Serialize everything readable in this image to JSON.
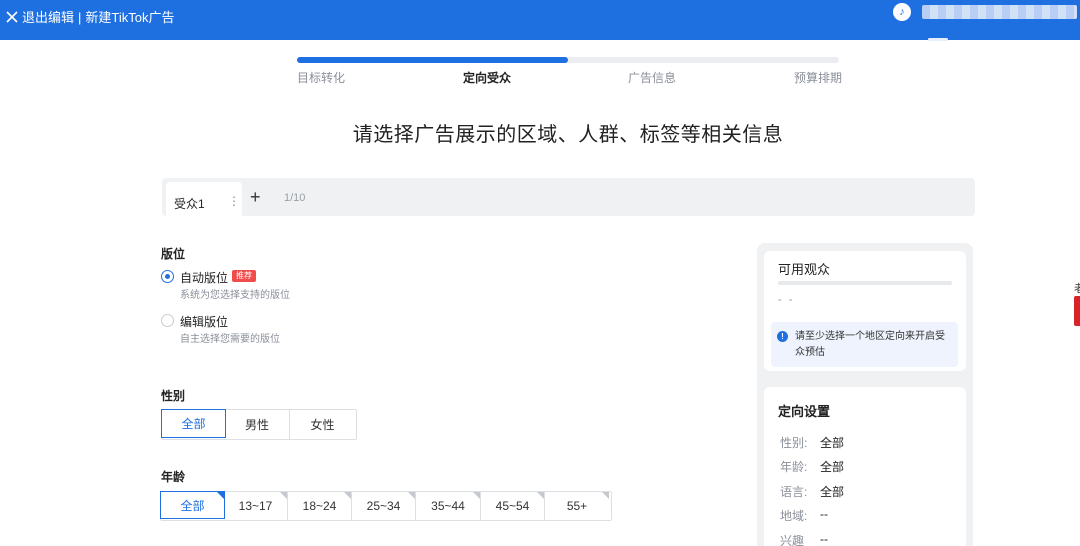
{
  "topbar": {
    "exit_label": "退出编辑",
    "separator": "|",
    "page_title": "新建TikTok广告",
    "avatar_glyph": "♪"
  },
  "steps": {
    "progress_fraction": 0.5,
    "items": [
      {
        "label": "目标转化",
        "active": false
      },
      {
        "label": "定向受众",
        "active": true
      },
      {
        "label": "广告信息",
        "active": false
      },
      {
        "label": "预算排期",
        "active": false
      }
    ]
  },
  "heading": "请选择广告展示的区域、人群、标签等相关信息",
  "audience_tabs": {
    "tabs": [
      {
        "label": "受众1",
        "more": "⋮"
      }
    ],
    "add_label": "+",
    "count": "1/10"
  },
  "placement": {
    "title": "版位",
    "options": [
      {
        "label": "自动版位",
        "desc": "系统为您选择支持的版位",
        "checked": true,
        "badge": "推荐"
      },
      {
        "label": "编辑版位",
        "desc": "自主选择您需要的版位",
        "checked": false
      }
    ]
  },
  "gender": {
    "title": "性别",
    "options": [
      "全部",
      "男性",
      "女性"
    ],
    "selected": "全部"
  },
  "age": {
    "title": "年龄",
    "options": [
      "全部",
      "13~17",
      "18~24",
      "25~34",
      "35~44",
      "45~54",
      "55+"
    ],
    "selected": "全部"
  },
  "available_audience": {
    "title": "可用观众",
    "value": "- -",
    "notice_icon": "!",
    "notice": "请至少选择一个地区定向来开启受众预估"
  },
  "targeting_settings": {
    "title": "定向设置",
    "rows": [
      {
        "key": "性别:",
        "value": "全部"
      },
      {
        "key": "年龄:",
        "value": "全部"
      },
      {
        "key": "语言:",
        "value": "全部"
      },
      {
        "key": "地域:",
        "value": "--"
      },
      {
        "key": "兴趣",
        "value": "--"
      }
    ]
  },
  "edge_text": "老",
  "colors": {
    "primary": "#1e6fe0",
    "badge": "#f04c4c",
    "topbar": "#1e6fe0"
  }
}
